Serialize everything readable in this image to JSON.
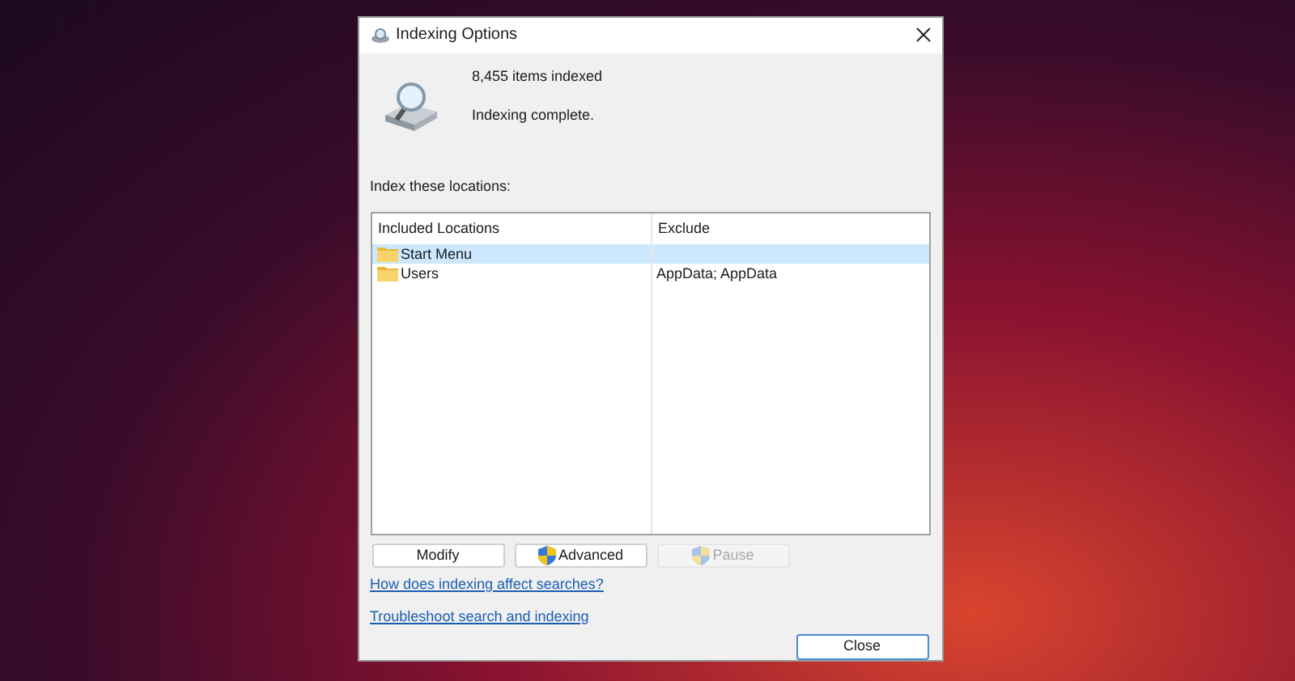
{
  "window": {
    "title": "Indexing Options"
  },
  "status": {
    "count": "8,455 items indexed",
    "message": "Indexing complete."
  },
  "locations_label": "Index these locations:",
  "table": {
    "columns": [
      "Included Locations",
      "Exclude"
    ],
    "rows": [
      {
        "location": "Start Menu",
        "exclude": "",
        "selected": true
      },
      {
        "location": "Users",
        "exclude": "AppData; AppData",
        "selected": false
      }
    ]
  },
  "buttons": [
    {
      "label": "Modify",
      "kind": "plain",
      "disabled": false
    },
    {
      "label": "Advanced",
      "kind": "shield",
      "disabled": false
    },
    {
      "label": "Pause",
      "kind": "shield",
      "disabled": true
    }
  ],
  "links": [
    "How does indexing affect searches?",
    "Troubleshoot search and indexing"
  ],
  "close_button": "Close"
}
